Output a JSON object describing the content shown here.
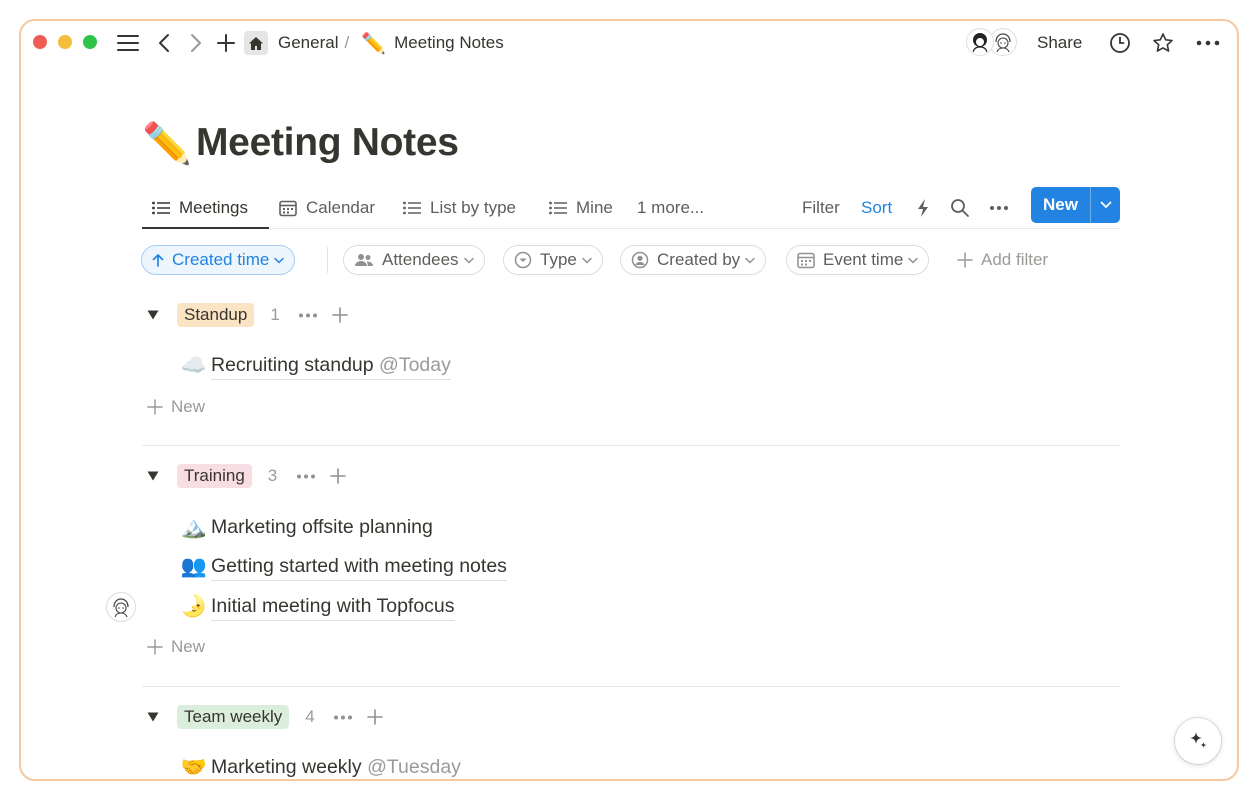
{
  "window": {
    "traffic_lights": [
      "close",
      "minimize",
      "zoom"
    ]
  },
  "breadcrumb": {
    "workspace": "General",
    "separator": "/",
    "page_emoji": "✏️",
    "page": "Meeting Notes"
  },
  "topbar": {
    "share_label": "Share"
  },
  "page": {
    "emoji": "✏️",
    "title": "Meeting Notes"
  },
  "views": {
    "tabs": [
      {
        "label": "Meetings",
        "icon": "list-icon",
        "active": true
      },
      {
        "label": "Calendar",
        "icon": "calendar-icon"
      },
      {
        "label": "List by type",
        "icon": "list-icon"
      },
      {
        "label": "Mine",
        "icon": "list-icon"
      }
    ],
    "more": "1 more...",
    "filter_label": "Filter",
    "sort_label": "Sort",
    "new_label": "New"
  },
  "filters": {
    "sort_chip": "Created time",
    "chips": [
      {
        "label": "Attendees",
        "icon": "people-icon"
      },
      {
        "label": "Type",
        "icon": "select-icon"
      },
      {
        "label": "Created by",
        "icon": "person-circle-icon"
      },
      {
        "label": "Event time",
        "icon": "calendar-icon"
      }
    ],
    "add_filter": "Add filter"
  },
  "groups": [
    {
      "tag": "Standup",
      "tag_color": "#fbe4c4",
      "count": "1",
      "items": [
        {
          "emoji": "☁️",
          "name": "Recruiting standup",
          "mention": "@Today"
        }
      ],
      "new_label": "New"
    },
    {
      "tag": "Training",
      "tag_color": "#f9dde5",
      "count": "3",
      "items": [
        {
          "emoji": "🏔️",
          "name": "Marketing offsite planning",
          "mention": ""
        },
        {
          "emoji": "👥",
          "name": "Getting started with meeting notes",
          "mention": ""
        },
        {
          "emoji": "🌛",
          "name": "Initial meeting with Topfocus",
          "mention": ""
        }
      ],
      "new_label": "New"
    },
    {
      "tag": "Team weekly",
      "tag_color": "#dbeddb",
      "count": "4",
      "items": [
        {
          "emoji": "🤝",
          "name": "Marketing weekly",
          "mention": "@Tuesday"
        }
      ]
    }
  ],
  "colors": {
    "accent": "#2383e2",
    "frame_border": "#f5c9a0",
    "text": "#37352f",
    "muted": "#9b9a97"
  }
}
